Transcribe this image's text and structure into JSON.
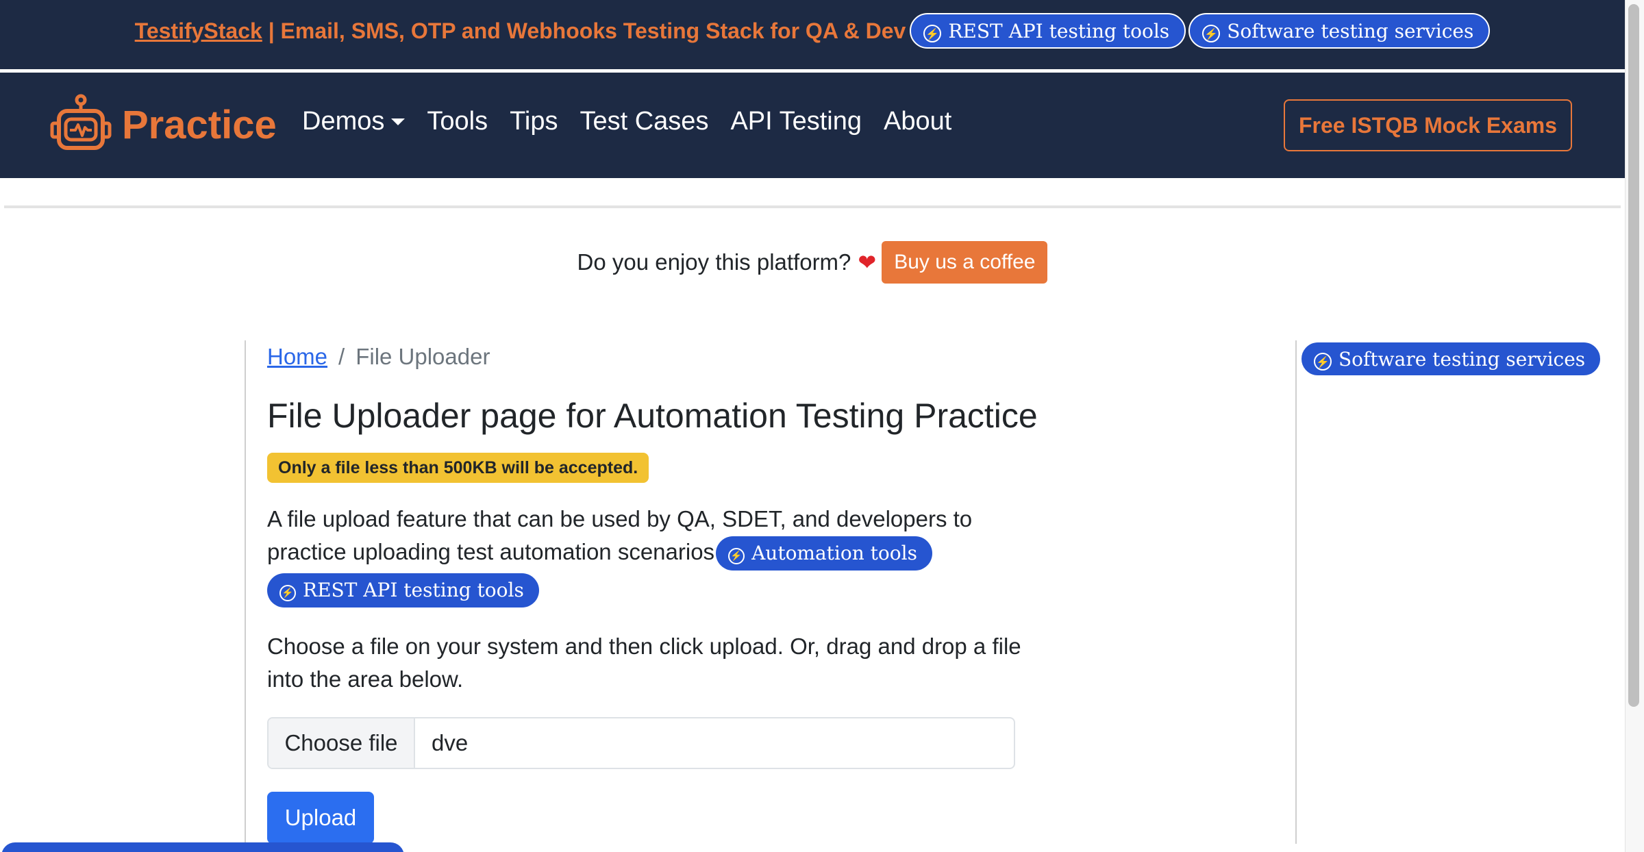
{
  "promo": {
    "brand_link": "TestifyStack",
    "tagline": " | Email, SMS, OTP and Webhooks Testing Stack for QA & Dev",
    "pill_1": "REST API testing tools",
    "pill_2": "Software testing services"
  },
  "navbar": {
    "brand": "Practice",
    "links": [
      "Demos",
      "Tools",
      "Tips",
      "Test Cases",
      "API Testing",
      "About"
    ],
    "cta": "Free ISTQB Mock Exams"
  },
  "coffee": {
    "text": "Do you enjoy this platform?",
    "heart": "❤",
    "button": "Buy us a coffee"
  },
  "breadcrumb": {
    "home": "Home",
    "separator": "/",
    "current": "File Uploader"
  },
  "main": {
    "title": "File Uploader page for Automation Testing Practice",
    "warning": "Only a file less than 500KB will be accepted.",
    "description": "A file upload feature that can be used by QA, SDET, and developers to practice uploading test automation scenarios",
    "pill_automation": "Automation tools",
    "pill_rest": "REST API testing tools",
    "instructions": "Choose a file on your system and then click upload. Or, drag and drop a file into the area below.",
    "file_button": "Choose file",
    "file_name": "dve",
    "upload_button": "Upload"
  },
  "sidebar": {
    "pill": "Software testing services"
  },
  "colors": {
    "navy": "#1d2a44",
    "orange": "#e8773a",
    "pill_blue": "#2655d0",
    "primary": "#2b6ef0",
    "warning": "#f2c232"
  },
  "icons": {
    "pill_icon": "bolt-circle-icon",
    "brand_icon": "robot-icon",
    "dropdown_icon": "caret-down-icon"
  }
}
